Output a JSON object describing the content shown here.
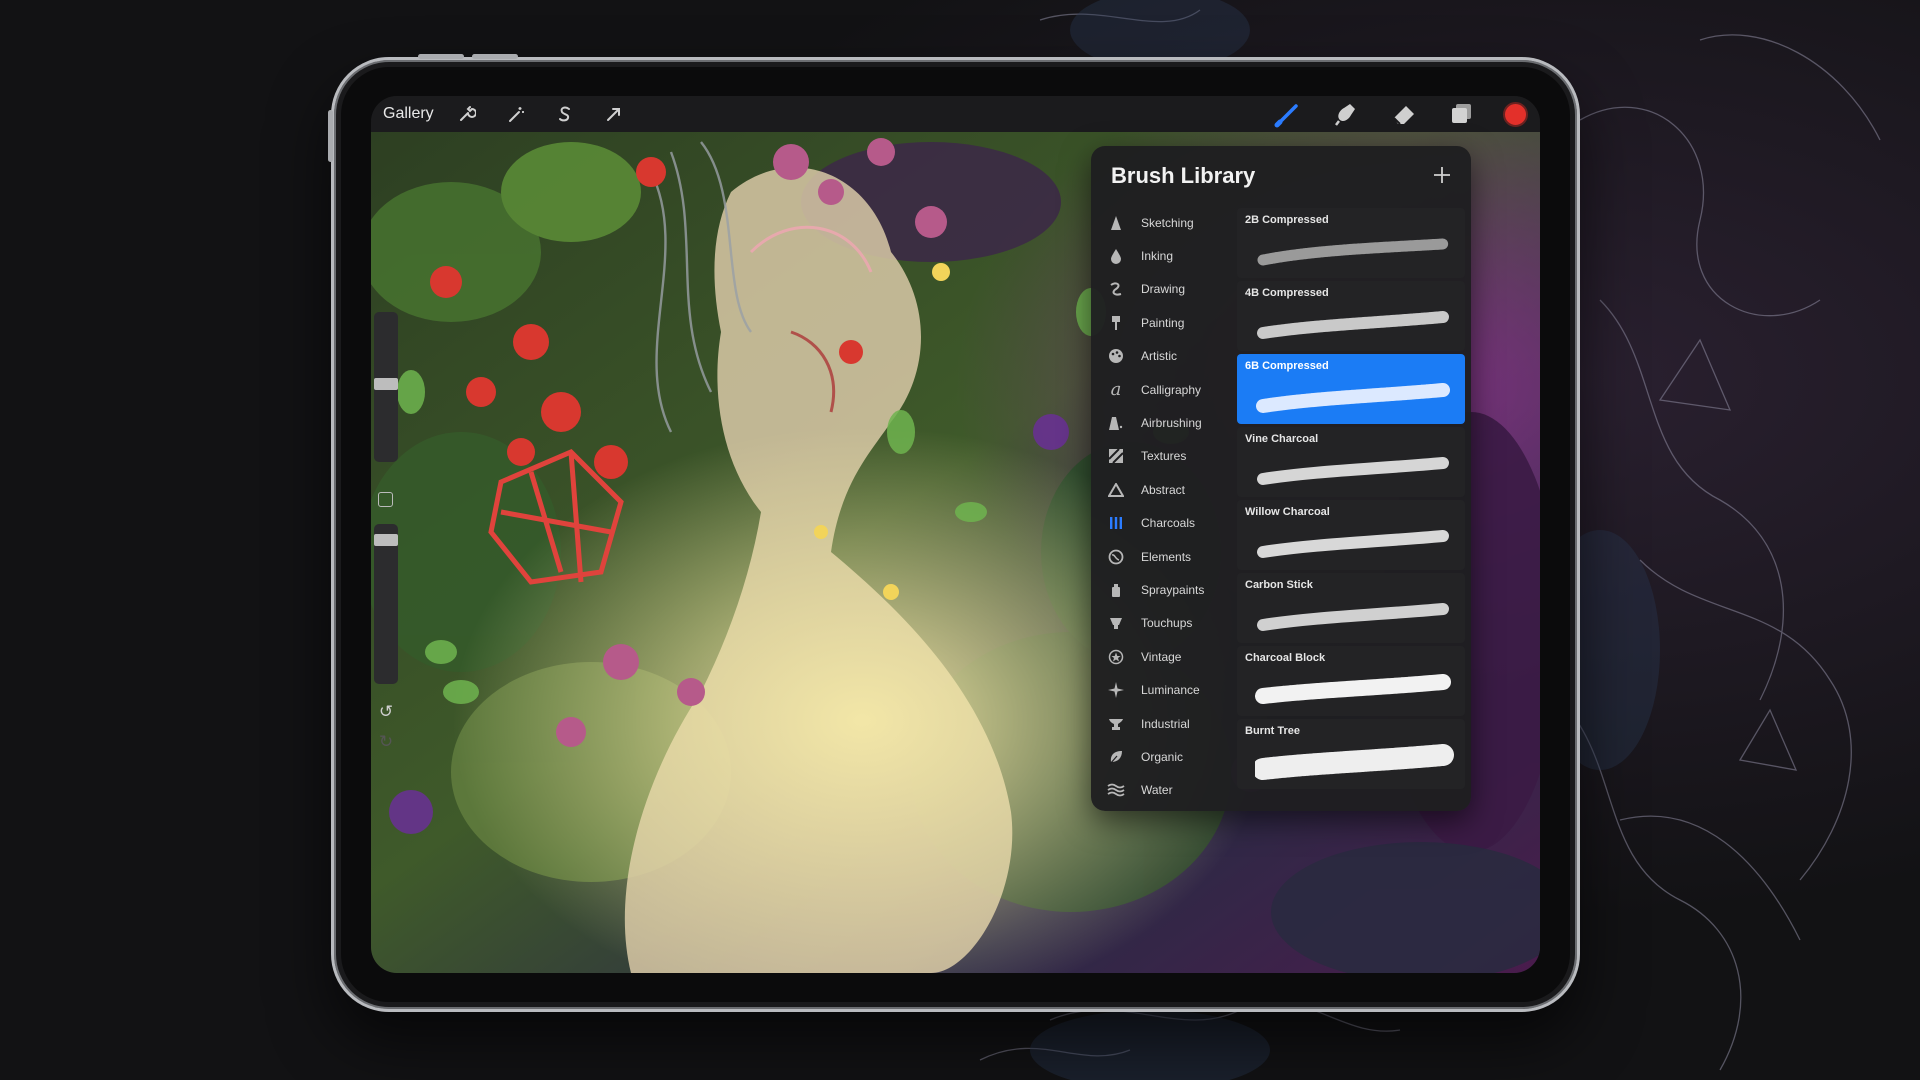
{
  "toolbar": {
    "gallery_label": "Gallery",
    "left_icons": [
      "wrench-icon",
      "magic-wand-icon",
      "selection-s-icon",
      "transform-arrow-icon"
    ],
    "right_icons": [
      "brush-icon",
      "smudge-icon",
      "eraser-icon",
      "layers-icon"
    ],
    "current_color": "#e3302a"
  },
  "panel": {
    "title": "Brush Library",
    "add_icon": "plus-icon",
    "categories": [
      {
        "label": "Sketching",
        "icon": "pencil-tip-icon"
      },
      {
        "label": "Inking",
        "icon": "ink-drop-icon"
      },
      {
        "label": "Drawing",
        "icon": "squiggle-icon"
      },
      {
        "label": "Painting",
        "icon": "paint-brush-icon"
      },
      {
        "label": "Artistic",
        "icon": "palette-icon"
      },
      {
        "label": "Calligraphy",
        "icon": "calligraphy-icon"
      },
      {
        "label": "Airbrushing",
        "icon": "airbrush-icon"
      },
      {
        "label": "Textures",
        "icon": "texture-icon"
      },
      {
        "label": "Abstract",
        "icon": "triangle-icon"
      },
      {
        "label": "Charcoals",
        "icon": "charcoal-sticks-icon",
        "active": true
      },
      {
        "label": "Elements",
        "icon": "globe-icon"
      },
      {
        "label": "Spraypaints",
        "icon": "spray-can-icon"
      },
      {
        "label": "Touchups",
        "icon": "touchup-icon"
      },
      {
        "label": "Vintage",
        "icon": "star-circle-icon"
      },
      {
        "label": "Luminance",
        "icon": "sparkle-icon"
      },
      {
        "label": "Industrial",
        "icon": "anvil-icon"
      },
      {
        "label": "Organic",
        "icon": "leaf-icon"
      },
      {
        "label": "Water",
        "icon": "waves-icon"
      }
    ],
    "brushes": [
      {
        "label": "2B Compressed",
        "selected": false
      },
      {
        "label": "4B Compressed",
        "selected": false
      },
      {
        "label": "6B Compressed",
        "selected": true
      },
      {
        "label": "Vine Charcoal",
        "selected": false
      },
      {
        "label": "Willow Charcoal",
        "selected": false
      },
      {
        "label": "Carbon Stick",
        "selected": false
      },
      {
        "label": "Charcoal Block",
        "selected": false
      },
      {
        "label": "Burnt Tree",
        "selected": false
      }
    ]
  },
  "sidebar": {
    "icons": [
      "brush-size-slider",
      "modify-square-icon",
      "opacity-slider",
      "undo-icon",
      "redo-icon"
    ]
  },
  "colors": {
    "accent": "#1b7cf5",
    "panel_bg": "#1e1e20"
  }
}
